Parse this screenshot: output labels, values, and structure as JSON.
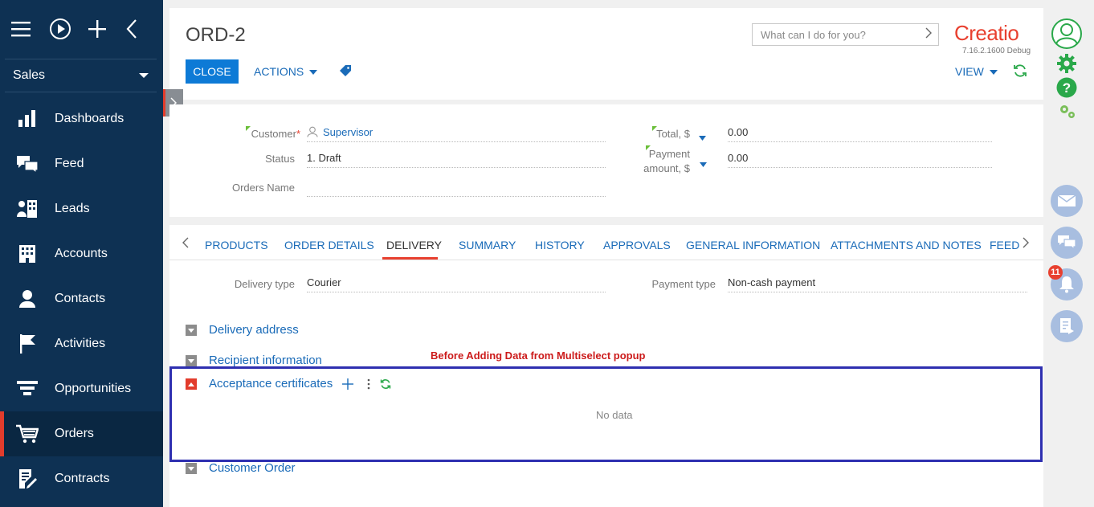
{
  "sidebar": {
    "workspace": "Sales",
    "items": [
      {
        "label": "Dashboards",
        "icon": "dashboards-icon"
      },
      {
        "label": "Feed",
        "icon": "feed-icon"
      },
      {
        "label": "Leads",
        "icon": "leads-icon"
      },
      {
        "label": "Accounts",
        "icon": "accounts-icon"
      },
      {
        "label": "Contacts",
        "icon": "contacts-icon"
      },
      {
        "label": "Activities",
        "icon": "activities-icon"
      },
      {
        "label": "Opportunities",
        "icon": "opportunities-icon"
      },
      {
        "label": "Orders",
        "icon": "orders-icon",
        "active": true
      },
      {
        "label": "Contracts",
        "icon": "contracts-icon"
      }
    ]
  },
  "header": {
    "title": "ORD-2",
    "close_label": "CLOSE",
    "actions_label": "ACTIONS",
    "search_placeholder": "What can I do for you?",
    "logo": "Creatio",
    "version": "7.16.2.1600 Debug",
    "view_label": "VIEW"
  },
  "fields": {
    "customer_label": "Customer",
    "customer_value": "Supervisor",
    "status_label": "Status",
    "status_value": "1. Draft",
    "orders_name_label": "Orders Name",
    "orders_name_value": "",
    "total_label": "Total, $",
    "total_value": "0.00",
    "payment_label_1": "Payment",
    "payment_label_2": "amount, $",
    "payment_value": "0.00"
  },
  "tabs": [
    "PRODUCTS",
    "ORDER DETAILS",
    "DELIVERY",
    "SUMMARY",
    "HISTORY",
    "APPROVALS",
    "GENERAL INFORMATION",
    "ATTACHMENTS AND NOTES",
    "FEED"
  ],
  "active_tab": "DELIVERY",
  "delivery": {
    "delivery_type_label": "Delivery type",
    "delivery_type_value": "Courier",
    "payment_type_label": "Payment type",
    "payment_type_value": "Non-cash payment",
    "groups": {
      "delivery_address": "Delivery address",
      "recipient_information": "Recipient information",
      "acceptance_certificates": "Acceptance certificates",
      "customer_order": "Customer Order"
    },
    "no_data": "No data"
  },
  "annotation": "Before Adding Data from Multiselect popup",
  "rail": {
    "notification_count": "11"
  },
  "colors": {
    "sidebar_bg": "#0e3153",
    "accent_blue": "#0d7ad6",
    "link_blue": "#1a6bb8",
    "brand_red": "#e8402f",
    "annotation_box": "#2e2fb0",
    "green": "#2aa84a"
  }
}
